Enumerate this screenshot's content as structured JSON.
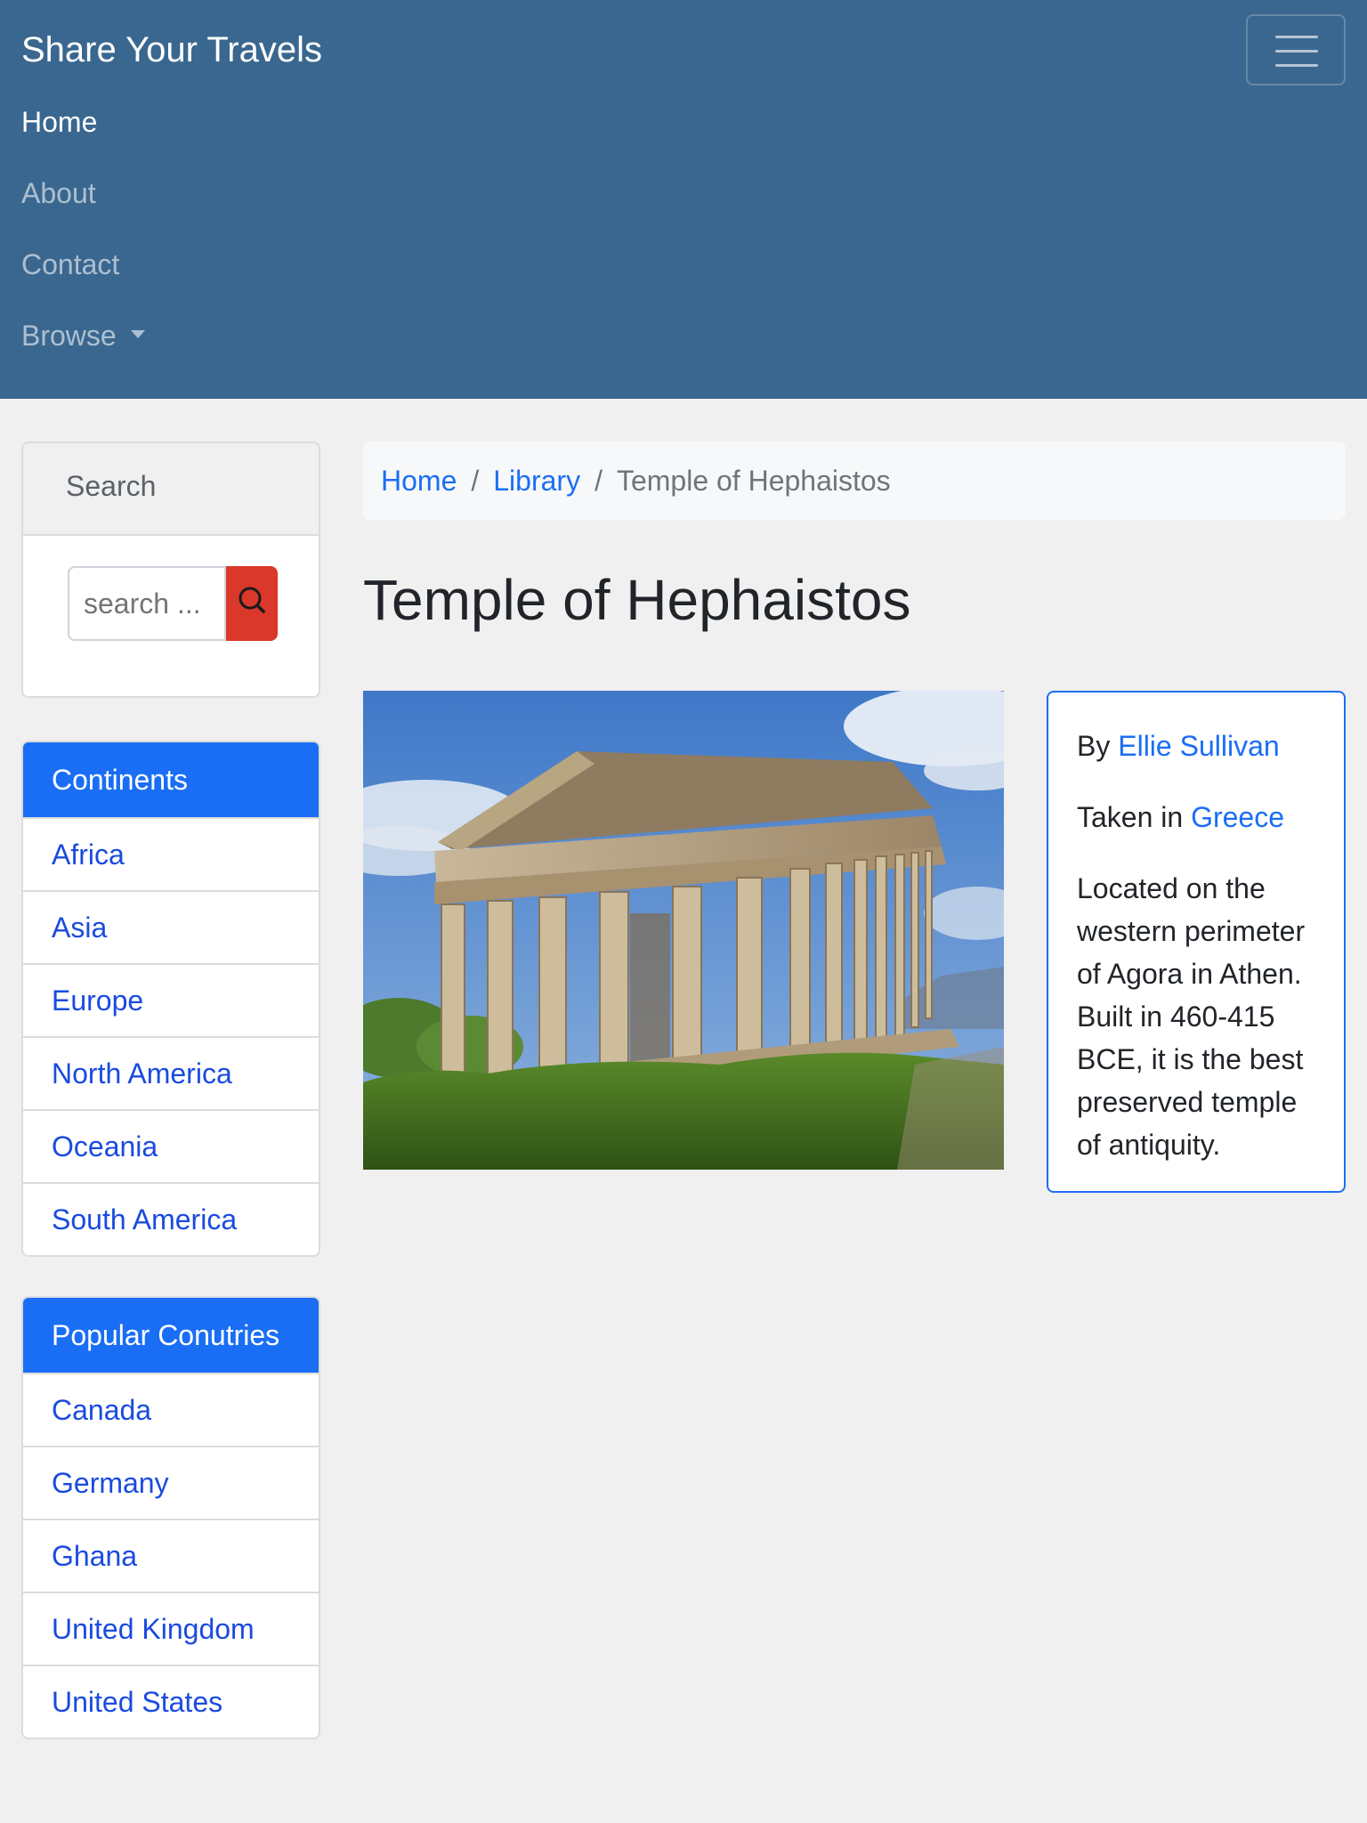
{
  "navbar": {
    "brand": "Share Your Travels",
    "items": [
      {
        "label": "Home",
        "active": true
      },
      {
        "label": "About",
        "active": false
      },
      {
        "label": "Contact",
        "active": false
      },
      {
        "label": "Browse",
        "active": false,
        "dropdown": true
      }
    ],
    "toggler_icon": "hamburger-icon"
  },
  "search": {
    "header": "Search",
    "placeholder": "search ...",
    "button_icon": "search-icon"
  },
  "continents": {
    "header": "Continents",
    "items": [
      "Africa",
      "Asia",
      "Europe",
      "North America",
      "Oceania",
      "South America"
    ]
  },
  "countries": {
    "header": "Popular Conutries",
    "items": [
      "Canada",
      "Germany",
      "Ghana",
      "United Kingdom",
      "United States"
    ]
  },
  "breadcrumb": {
    "home": "Home",
    "library": "Library",
    "current": "Temple of Hephaistos",
    "separator": "/"
  },
  "photo": {
    "title": "Temple of Hephaistos",
    "by_prefix": "By",
    "author": "Ellie Sullivan",
    "taken_prefix": "Taken in",
    "country": "Greece",
    "description": "Located on the western perimeter of Agora in Athen. Built in 460-415 BCE, it is the best preserved temple of antiquity."
  },
  "colors": {
    "navbar": "#3a678f",
    "primary": "#1a6ef5",
    "search_button": "#d9382a",
    "page_background": "#f0f0f0"
  }
}
